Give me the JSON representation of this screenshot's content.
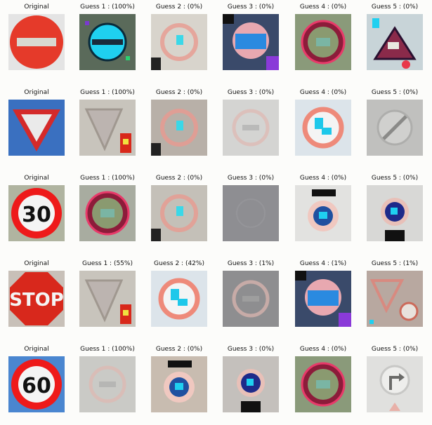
{
  "rows": [
    {
      "row_name": "no-entry",
      "cells": [
        {
          "title": "Original",
          "sign": "no-entry-original",
          "bg": "#e8e8e8"
        },
        {
          "title": "Guess 1 : (100%)",
          "sign": "no-entry-cyan",
          "bg": "#5a6a5a"
        },
        {
          "title": "Guess 2 : (0%)",
          "sign": "faint-circle",
          "bg": "#d8d4cc"
        },
        {
          "title": "Guess 3 : (0%)",
          "sign": "stop-noisy",
          "bg": "#3a4a6a"
        },
        {
          "title": "Guess 4 : (0%)",
          "sign": "speed-dark",
          "bg": "#8a9a7a"
        },
        {
          "title": "Guess 5 : (0%)",
          "sign": "triangle-noisy",
          "bg": "#c8d4d8"
        }
      ]
    },
    {
      "row_name": "yield",
      "cells": [
        {
          "title": "Original",
          "sign": "yield-original",
          "bg": "#3a70c0"
        },
        {
          "title": "Guess 1 : (100%)",
          "sign": "yield-faint",
          "bg": "#c8c4bc"
        },
        {
          "title": "Guess 2 : (0%)",
          "sign": "faint-circle",
          "bg": "#b8b0a8"
        },
        {
          "title": "Guess 3 : (0%)",
          "sign": "faint-circle-gray",
          "bg": "#d4d4d2"
        },
        {
          "title": "Guess 4 : (0%)",
          "sign": "circle-cyan",
          "bg": "#dce4ea"
        },
        {
          "title": "Guess 5 : (0%)",
          "sign": "end-restriction",
          "bg": "#c0c0be"
        }
      ]
    },
    {
      "row_name": "speed-30",
      "cells": [
        {
          "title": "Original",
          "sign": "speed-30-original",
          "bg": "#b0b4a0",
          "number": "30"
        },
        {
          "title": "Guess 1 : (100%)",
          "sign": "speed-dark",
          "bg": "#a8aca0"
        },
        {
          "title": "Guess 2 : (0%)",
          "sign": "faint-circle",
          "bg": "#c4c0b8"
        },
        {
          "title": "Guess 3 : (0%)",
          "sign": "gray-square",
          "bg": "#8e8e92"
        },
        {
          "title": "Guess 4 : (0%)",
          "sign": "roundabout",
          "bg": "#e2e2e0"
        },
        {
          "title": "Guess 5 : (0%)",
          "sign": "roundabout-blue",
          "bg": "#d8d8d6"
        }
      ]
    },
    {
      "row_name": "stop",
      "cells": [
        {
          "title": "Original",
          "sign": "stop-original",
          "bg": "#c8c0b8",
          "text": "STOP"
        },
        {
          "title": "Guess 1 : (55%)",
          "sign": "yield-faint",
          "bg": "#c8c4bc"
        },
        {
          "title": "Guess 2 : (42%)",
          "sign": "circle-cyan",
          "bg": "#dce4ea"
        },
        {
          "title": "Guess 3 : (1%)",
          "sign": "faint-circle-gray",
          "bg": "#8e8e90"
        },
        {
          "title": "Guess 4 : (1%)",
          "sign": "stop-noisy",
          "bg": "#3a4a6a"
        },
        {
          "title": "Guess 5 : (1%)",
          "sign": "triangle-faint",
          "bg": "#b8a8a0"
        }
      ]
    },
    {
      "row_name": "speed-60",
      "cells": [
        {
          "title": "Original",
          "sign": "speed-60-original",
          "bg": "#4a86d0",
          "number": "60"
        },
        {
          "title": "Guess 1 : (100%)",
          "sign": "faint-circle-gray",
          "bg": "#cacac6"
        },
        {
          "title": "Guess 2 : (0%)",
          "sign": "roundabout",
          "bg": "#c8bcb0"
        },
        {
          "title": "Guess 3 : (0%)",
          "sign": "roundabout-blue",
          "bg": "#c4c0bc"
        },
        {
          "title": "Guess 4 : (0%)",
          "sign": "speed-dark",
          "bg": "#8a9a7a"
        },
        {
          "title": "Guess 5 : (0%)",
          "sign": "turn-right",
          "bg": "#e0e0de"
        }
      ]
    }
  ]
}
